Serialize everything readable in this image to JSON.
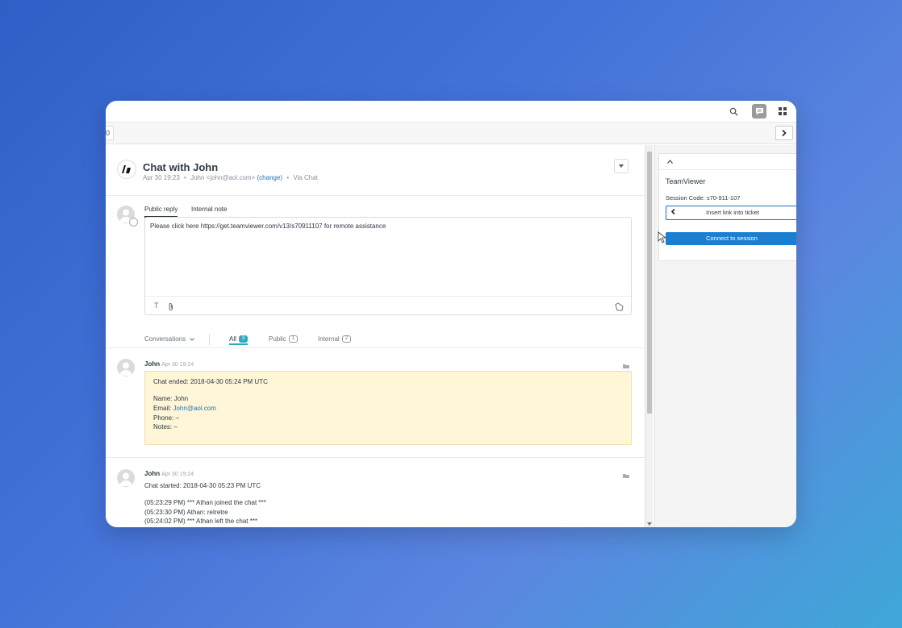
{
  "topbar": {
    "icons": [
      "search-icon",
      "chat-icon",
      "apps-grid-icon"
    ]
  },
  "tabbar": {
    "stub_label": "0"
  },
  "ticket": {
    "title": "Chat with John",
    "date": "Apr 30 19:23",
    "requester": "John <john@aol.com>",
    "change_link": "(change)",
    "channel": "Via Chat"
  },
  "composer": {
    "tabs": [
      "Public reply",
      "Internal note"
    ],
    "text": "Please click here https://get.teamviewer.com/v13/s70911107 for remote assistance"
  },
  "filters": {
    "conversations_label": "Conversations",
    "all_label": "All",
    "all_count": "3",
    "public_label": "Public",
    "public_count": "1",
    "internal_label": "Internal",
    "internal_count": "2"
  },
  "messages": [
    {
      "author": "John",
      "time": "Apr 30 19:24",
      "chat_ended": "Chat ended: 2018-04-30 05:24 PM UTC",
      "name_line": "Name: John",
      "email_label": "Email:",
      "email_value": "John@aol.com",
      "phone_line": "Phone: –",
      "notes_line": "Notes: –"
    },
    {
      "author": "John",
      "time": "Apr 30 19:24",
      "chat_started": "Chat started: 2018-04-30 05:23 PM UTC",
      "log": [
        "(05:23:29 PM) *** Athan joined the chat ***",
        "(05:23:30 PM) Athan: retretre",
        "(05:24:02 PM) *** Athan left the chat ***"
      ]
    }
  ],
  "app": {
    "title": "TeamViewer",
    "session_code": "Session Code: s70-911-107",
    "insert_label": "Insert link into ticket",
    "connect_label": "Connect to session"
  },
  "colors": {
    "accent": "#1a7fd0",
    "note_bg": "#fff6d8",
    "badge_active": "#30aabc"
  }
}
